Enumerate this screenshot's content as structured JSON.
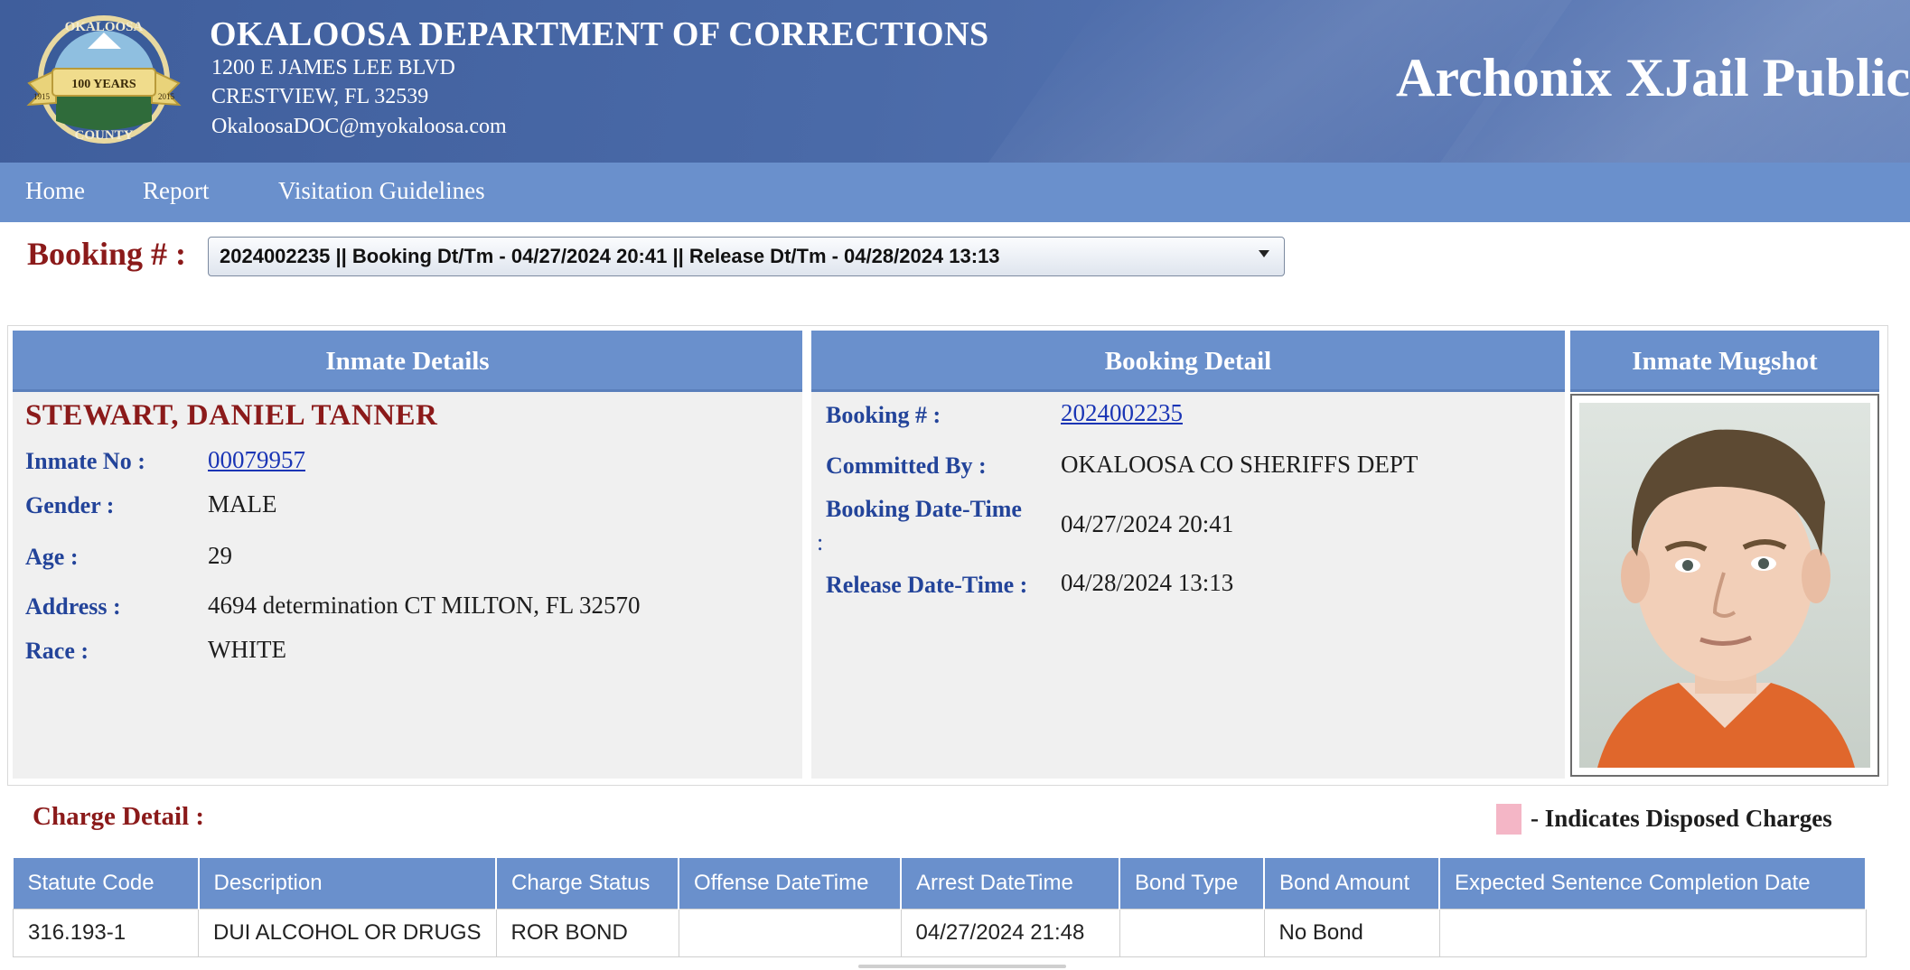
{
  "header": {
    "department": "OKALOOSA DEPARTMENT OF CORRECTIONS",
    "address_line1": "1200 E JAMES LEE BLVD",
    "address_line2": "CRESTVIEW, FL 32539",
    "email": "OkaloosaDOC@myokaloosa.com",
    "brand": "Archonix XJail Public",
    "seal": {
      "top_text": "OKALOOSA",
      "ribbon_text": "100 YEARS",
      "bottom_text": "COUNTY",
      "left_year": "1915",
      "right_year": "2015"
    }
  },
  "nav": {
    "items": [
      {
        "label": "Home"
      },
      {
        "label": "Report"
      },
      {
        "label": "Visitation Guidelines"
      }
    ]
  },
  "booking": {
    "label": "Booking # :",
    "selected": "2024002235 || Booking Dt/Tm - 04/27/2024 20:41 || Release Dt/Tm - 04/28/2024 13:13"
  },
  "inmate_details": {
    "title": "Inmate Details",
    "name": "STEWART, DANIEL TANNER",
    "fields": {
      "inmate_no_label": "Inmate No :",
      "inmate_no": "00079957",
      "gender_label": "Gender :",
      "gender": "MALE",
      "age_label": "Age :",
      "age": "29",
      "address_label": "Address :",
      "address": "4694 determination CT MILTON, FL 32570",
      "race_label": "Race :",
      "race": "WHITE"
    }
  },
  "booking_detail": {
    "title": "Booking Detail",
    "booking_no_label": "Booking # :",
    "booking_no": "2024002235",
    "committed_by_label": "Committed By :",
    "committed_by": "OKALOOSA CO SHERIFFS DEPT",
    "booking_dt_label": "Booking Date-Time",
    "booking_dt_colon": ":",
    "booking_dt": "04/27/2024 20:41",
    "release_dt_label": "Release Date-Time :",
    "release_dt": "04/28/2024 13:13"
  },
  "mugshot": {
    "title": "Inmate Mugshot"
  },
  "charges": {
    "title": "Charge Detail :",
    "legend": "- Indicates Disposed Charges",
    "legend_color": "#f4b6c6",
    "columns": [
      "Statute Code",
      "Description",
      "Charge Status",
      "Offense DateTime",
      "Arrest DateTime",
      "Bond Type",
      "Bond Amount",
      "Expected Sentence Completion Date"
    ],
    "rows": [
      [
        "316.193-1",
        "DUI ALCOHOL OR DRUGS",
        "ROR BOND",
        "",
        "04/27/2024 21:48",
        "",
        "No Bond",
        ""
      ]
    ]
  },
  "colors": {
    "header_blue": "#4a6aa8",
    "nav_blue": "#6a90cc",
    "label_blue": "#23449a",
    "name_red": "#8b1a1a",
    "panel_gray": "#f0f0f0"
  }
}
